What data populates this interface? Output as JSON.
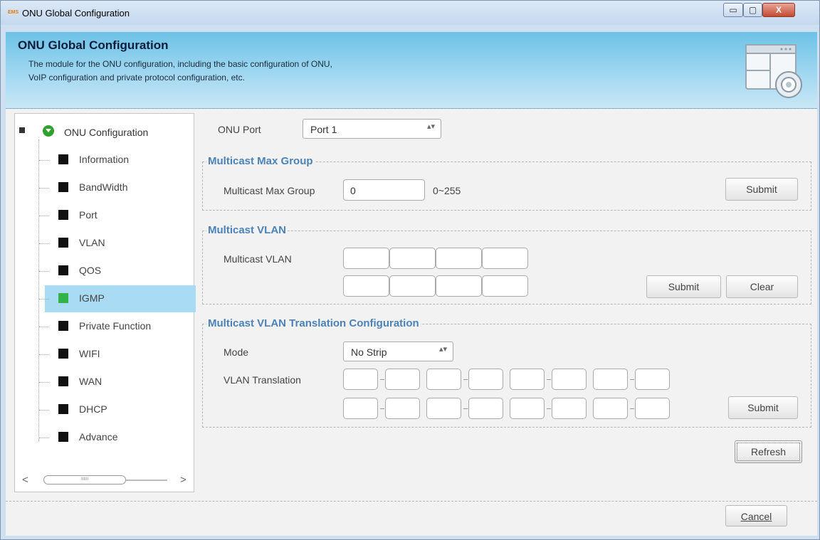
{
  "window": {
    "app_badge": "EMS",
    "title": "ONU Global Configuration",
    "min_glyph": "▭",
    "max_glyph": "▢",
    "close_glyph": "X"
  },
  "banner": {
    "title": "ONU Global Configuration",
    "description_line1": "The module for the ONU configuration, including the basic configuration of ONU,",
    "description_line2": "VoIP configuration and private protocol configuration, etc."
  },
  "tree": {
    "root_label": "ONU Configuration",
    "items": [
      {
        "label": "Information",
        "selected": false
      },
      {
        "label": "BandWidth",
        "selected": false
      },
      {
        "label": "Port",
        "selected": false
      },
      {
        "label": "VLAN",
        "selected": false
      },
      {
        "label": "QOS",
        "selected": false
      },
      {
        "label": "IGMP",
        "selected": true
      },
      {
        "label": "Private Function",
        "selected": false
      },
      {
        "label": "WIFI",
        "selected": false
      },
      {
        "label": "WAN",
        "selected": false
      },
      {
        "label": "DHCP",
        "selected": false
      },
      {
        "label": "Advance",
        "selected": false
      }
    ],
    "scroll_left": "<",
    "scroll_right": ">",
    "scroll_grip": "IIIIII"
  },
  "onu_port": {
    "label": "ONU Port",
    "value": "Port 1",
    "arrows": "▴▾"
  },
  "max_group": {
    "title": "Multicast Max Group",
    "field_label": "Multicast Max Group",
    "value": "0",
    "range": "0~255",
    "submit": "Submit"
  },
  "multicast_vlan": {
    "title": "Multicast VLAN",
    "field_label": "Multicast VLAN",
    "submit": "Submit",
    "clear": "Clear"
  },
  "translation": {
    "title": "Multicast VLAN Translation Configuration",
    "mode_label": "Mode",
    "mode_value": "No Strip",
    "arrows": "▴▾",
    "vlan_label": "VLAN Translation",
    "submit": "Submit"
  },
  "actions": {
    "refresh": "Refresh",
    "cancel": "Cancel"
  },
  "colors": {
    "group_title": "#4b82b8",
    "selected_row": "#a9dcf4",
    "selected_icon": "#34b24a"
  }
}
